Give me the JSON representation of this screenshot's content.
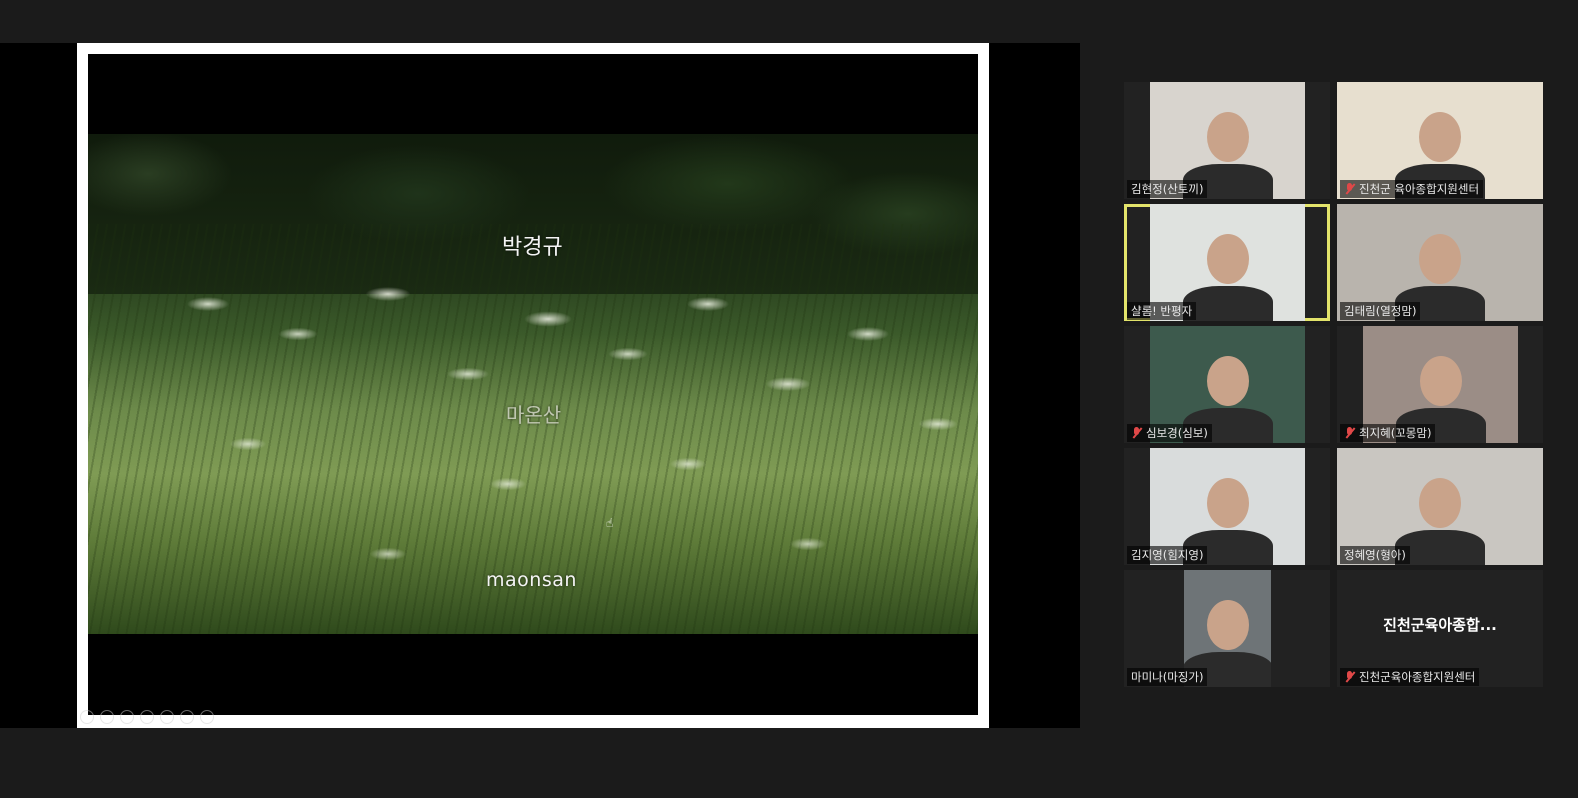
{
  "presentation": {
    "title_ko": "박경규",
    "subtitle_ko": "마온산",
    "title_en": "maonsan"
  },
  "participants": [
    {
      "name": "김현정(산토끼)",
      "muted": false,
      "active": false,
      "has_video": true,
      "bg": "#d8d4ce"
    },
    {
      "name": "진천군 육아종합지원센터",
      "muted": true,
      "active": false,
      "has_video": true,
      "bg": "#e7dfcf"
    },
    {
      "name": "샬롬! 반평자",
      "muted": false,
      "active": true,
      "has_video": true,
      "bg": "#dfe2df"
    },
    {
      "name": "김태림(열정맘)",
      "muted": false,
      "active": false,
      "has_video": true,
      "bg": "#b9b4ad"
    },
    {
      "name": "심보경(심보)",
      "muted": true,
      "active": false,
      "has_video": true,
      "bg": "#3d5a4d"
    },
    {
      "name": "최지혜(꼬몽맘)",
      "muted": true,
      "active": false,
      "has_video": true,
      "bg": "#9b8d86"
    },
    {
      "name": "김지영(힘지영)",
      "muted": false,
      "active": false,
      "has_video": true,
      "bg": "#d9dcdc"
    },
    {
      "name": "정혜영(형아)",
      "muted": false,
      "active": false,
      "has_video": true,
      "bg": "#c9c6c1"
    },
    {
      "name": "마미나(마징가)",
      "muted": false,
      "active": false,
      "has_video": true,
      "bg": "#6e7477"
    },
    {
      "name": "진천군육아종합지원센터",
      "muted": true,
      "active": false,
      "has_video": false,
      "display_text": "진천군육아종합...",
      "bg": "#222222"
    }
  ]
}
